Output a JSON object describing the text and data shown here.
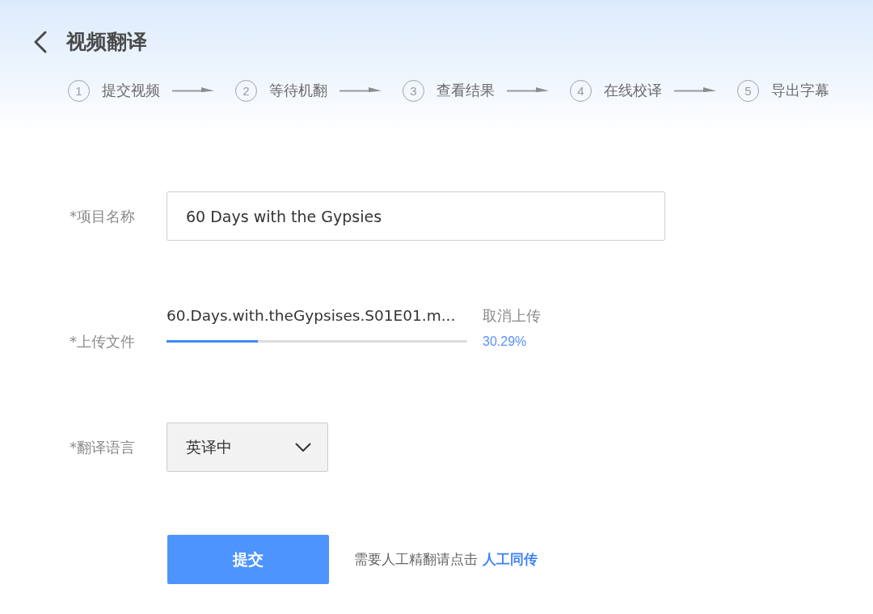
{
  "header": {
    "title": "视频翻译"
  },
  "steps": [
    {
      "number": "1",
      "label": "提交视频"
    },
    {
      "number": "2",
      "label": "等待机翻"
    },
    {
      "number": "3",
      "label": "查看结果"
    },
    {
      "number": "4",
      "label": "在线校译"
    },
    {
      "number": "5",
      "label": "导出字幕"
    }
  ],
  "form": {
    "fields": [
      {
        "kind": "text",
        "label": "*项目名称",
        "value": "60 Days with the Gypsies"
      },
      {
        "kind": "upload",
        "label": "*上传文件",
        "file_name": "60.Days.with.theGypsises.S01E01.m...",
        "cancel": "取消上传",
        "level": 0.3029,
        "reading": "30.29%"
      },
      {
        "kind": "select",
        "label": "*翻译语言",
        "value": "英译中"
      }
    ],
    "submit": {
      "label": "提交",
      "note": "需要人工精翻请点击",
      "link": "人工同传"
    }
  }
}
